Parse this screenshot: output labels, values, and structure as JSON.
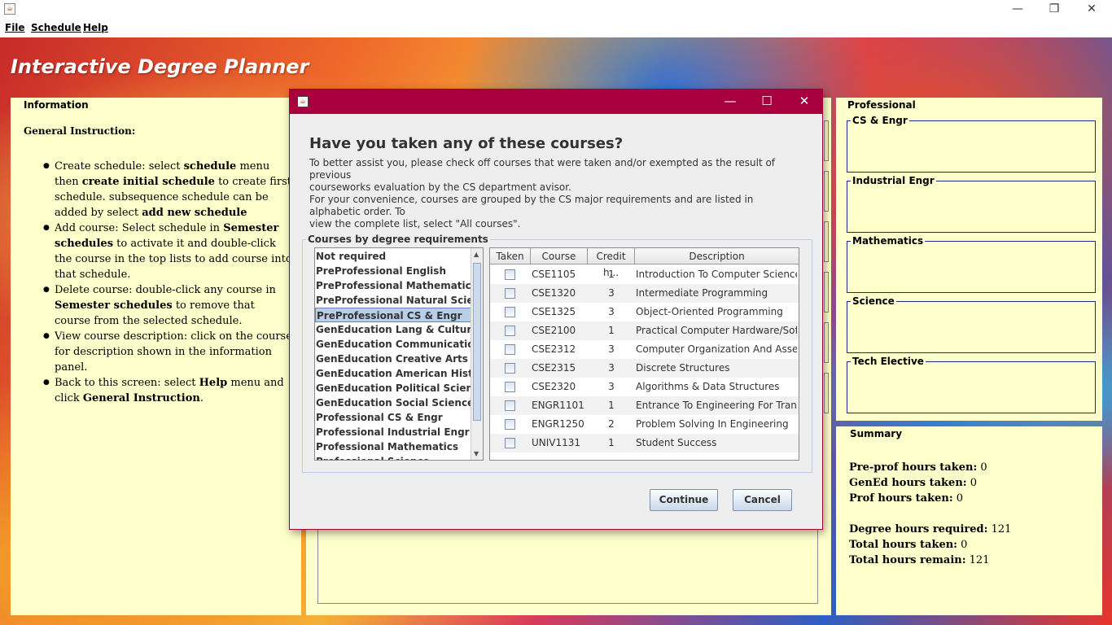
{
  "window": {
    "icon": "java-cup-icon",
    "controls": {
      "minimize": "—",
      "restore": "❐",
      "close": "✕"
    }
  },
  "menu": [
    "File",
    "Schedule",
    "Help"
  ],
  "app_title": "Interactive Degree Planner",
  "info": {
    "title": "Information",
    "heading": "General Instruction:",
    "items": [
      [
        "Create schedule: select ",
        "schedule",
        " menu then ",
        "create initial schedule",
        " to create first schedule. subsequence schedule can be added by select ",
        "add new schedule",
        ""
      ],
      [
        "Add course: Select schedule in ",
        "Semester schedules",
        " to activate it and double-click the course in the top lists to add course into that schedule.",
        "",
        "",
        "",
        ""
      ],
      [
        "Delete course: double-click any course in ",
        "Semester schedules",
        " to remove that course from the selected schedule.",
        "",
        "",
        "",
        ""
      ],
      [
        "View course description: click on the course for description shown in the information panel.",
        "",
        "",
        "",
        "",
        "",
        ""
      ],
      [
        "Back to this screen: select ",
        "Help",
        " menu and click ",
        "General Instruction",
        ".",
        "",
        ""
      ]
    ]
  },
  "professional": {
    "title": "Professional",
    "groups": [
      "CS & Engr",
      "Industrial Engr",
      "Mathematics",
      "Science",
      "Tech Elective"
    ]
  },
  "summary": {
    "title": "Summary",
    "lines": [
      {
        "label": "Pre-prof hours taken:",
        "value": "0"
      },
      {
        "label": "GenEd hours taken:",
        "value": "0"
      },
      {
        "label": "Prof hours taken:",
        "value": "0"
      },
      {
        "label": "Degree hours required:",
        "value": "121"
      },
      {
        "label": "Total hours taken:",
        "value": "0"
      },
      {
        "label": "Total hours remain:",
        "value": "121"
      }
    ]
  },
  "dialog": {
    "icon": "java-cup-icon",
    "controls": {
      "minimize": "—",
      "maximize": "☐",
      "close": "✕"
    },
    "heading": "Have you taken any of these courses?",
    "para1_line1": "To better assist you, please check off courses that were taken and/or exempted as the result of previous",
    "para1_line2": "courseworks evaluation by the CS department avisor.",
    "para2_line1": "For your convenience, courses are grouped by the CS major requirements and are listed in alphabetic order. To",
    "para2_line2": "view the complete list, select \"All courses\".",
    "group_label": "Courses by degree requirements",
    "requirements": [
      "Not required",
      "PreProfessional English",
      "PreProfessional Mathematics",
      "PreProfessional Natural Science",
      "PreProfessional CS & Engr",
      "GenEducation Lang & Culture",
      "GenEducation Communication",
      "GenEducation Creative Arts",
      "GenEducation American History",
      "GenEducation Political Science",
      "GenEducation Social Science",
      "Professional CS & Engr",
      "Professional Industrial Engr",
      "Professional Mathematics",
      "Professional Science"
    ],
    "selected_requirement": "PreProfessional CS & Engr",
    "columns": [
      "Taken",
      "Course",
      "Credit h...",
      "Description"
    ],
    "courses": [
      {
        "course": "CSE1105",
        "credit": "1",
        "description": "Introduction To Computer Science"
      },
      {
        "course": "CSE1320",
        "credit": "3",
        "description": "Intermediate Programming"
      },
      {
        "course": "CSE1325",
        "credit": "3",
        "description": "Object-Oriented Programming"
      },
      {
        "course": "CSE2100",
        "credit": "1",
        "description": "Practical Computer Hardware/Soft..."
      },
      {
        "course": "CSE2312",
        "credit": "3",
        "description": "Computer Organization And Asse..."
      },
      {
        "course": "CSE2315",
        "credit": "3",
        "description": "Discrete Structures"
      },
      {
        "course": "CSE2320",
        "credit": "3",
        "description": "Algorithms & Data Structures"
      },
      {
        "course": "ENGR1101",
        "credit": "1",
        "description": "Entrance To Engineering For Tran..."
      },
      {
        "course": "ENGR1250",
        "credit": "2",
        "description": "Problem Solving In Engineering"
      },
      {
        "course": "UNIV1131",
        "credit": "1",
        "description": "Student Success"
      }
    ],
    "buttons": {
      "continue": "Continue",
      "cancel": "Cancel"
    }
  },
  "colors": {
    "dialog_titlebar": "#a8003e",
    "panel_bg": "#ffffcc",
    "selection": "#b8cfe5"
  }
}
